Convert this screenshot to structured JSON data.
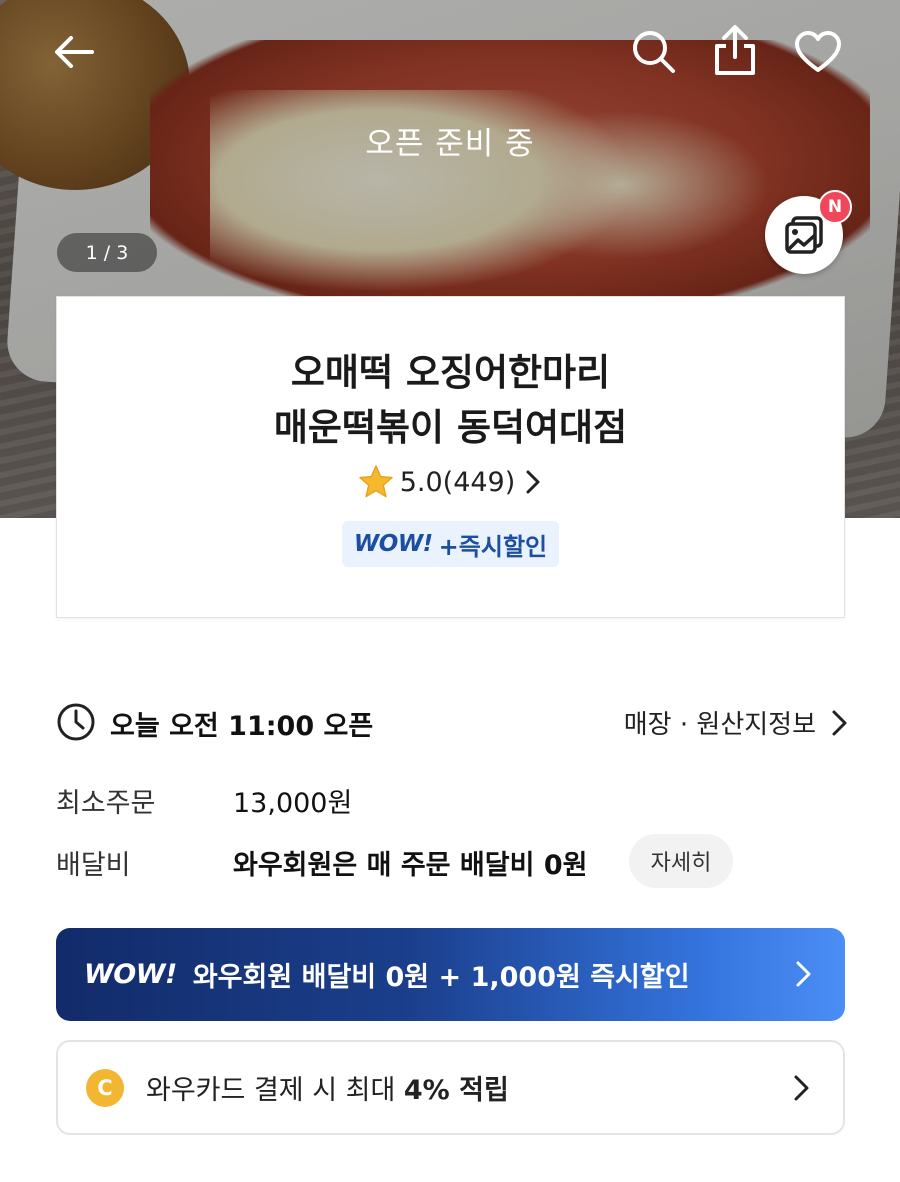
{
  "hero": {
    "status_text": "오픈 준비 중",
    "image_counter": "1 / 3",
    "new_badge": "N",
    "icons": [
      "back-arrow-icon",
      "search-icon",
      "share-icon",
      "heart-icon",
      "gallery-icon"
    ]
  },
  "store": {
    "name_line1": "오매떡 오징어한마리",
    "name_line2": "매운떡볶이 동덕여대점",
    "rating": "5.0(449)",
    "badge_logo": "WOW!",
    "badge_text": "+즉시할인"
  },
  "info": {
    "hours": "오늘 오전 11:00 오픈",
    "origin_link": "매장 · 원산지정보",
    "min_order_label": "최소주문",
    "min_order_value": "13,000원",
    "delivery_fee_label": "배달비",
    "delivery_fee_value": "와우회원은 매 주문 배달비 0원",
    "detail_button": "자세히"
  },
  "promos": {
    "wow_logo": "WOW!",
    "wow_banner_text": "와우회원 배달비 0원 + 1,000원 즉시할인",
    "coin_label": "C",
    "card_banner_prefix": "와우카드 결제 시 최대 ",
    "card_banner_highlight": "4% 적립"
  },
  "colors": {
    "accent_blue": "#1d4fa0",
    "banner_dark": "#122b6a",
    "banner_light": "#4b8ef5",
    "star": "#f5b82e",
    "badge_red": "#f0475a",
    "coin": "#f2b632"
  }
}
